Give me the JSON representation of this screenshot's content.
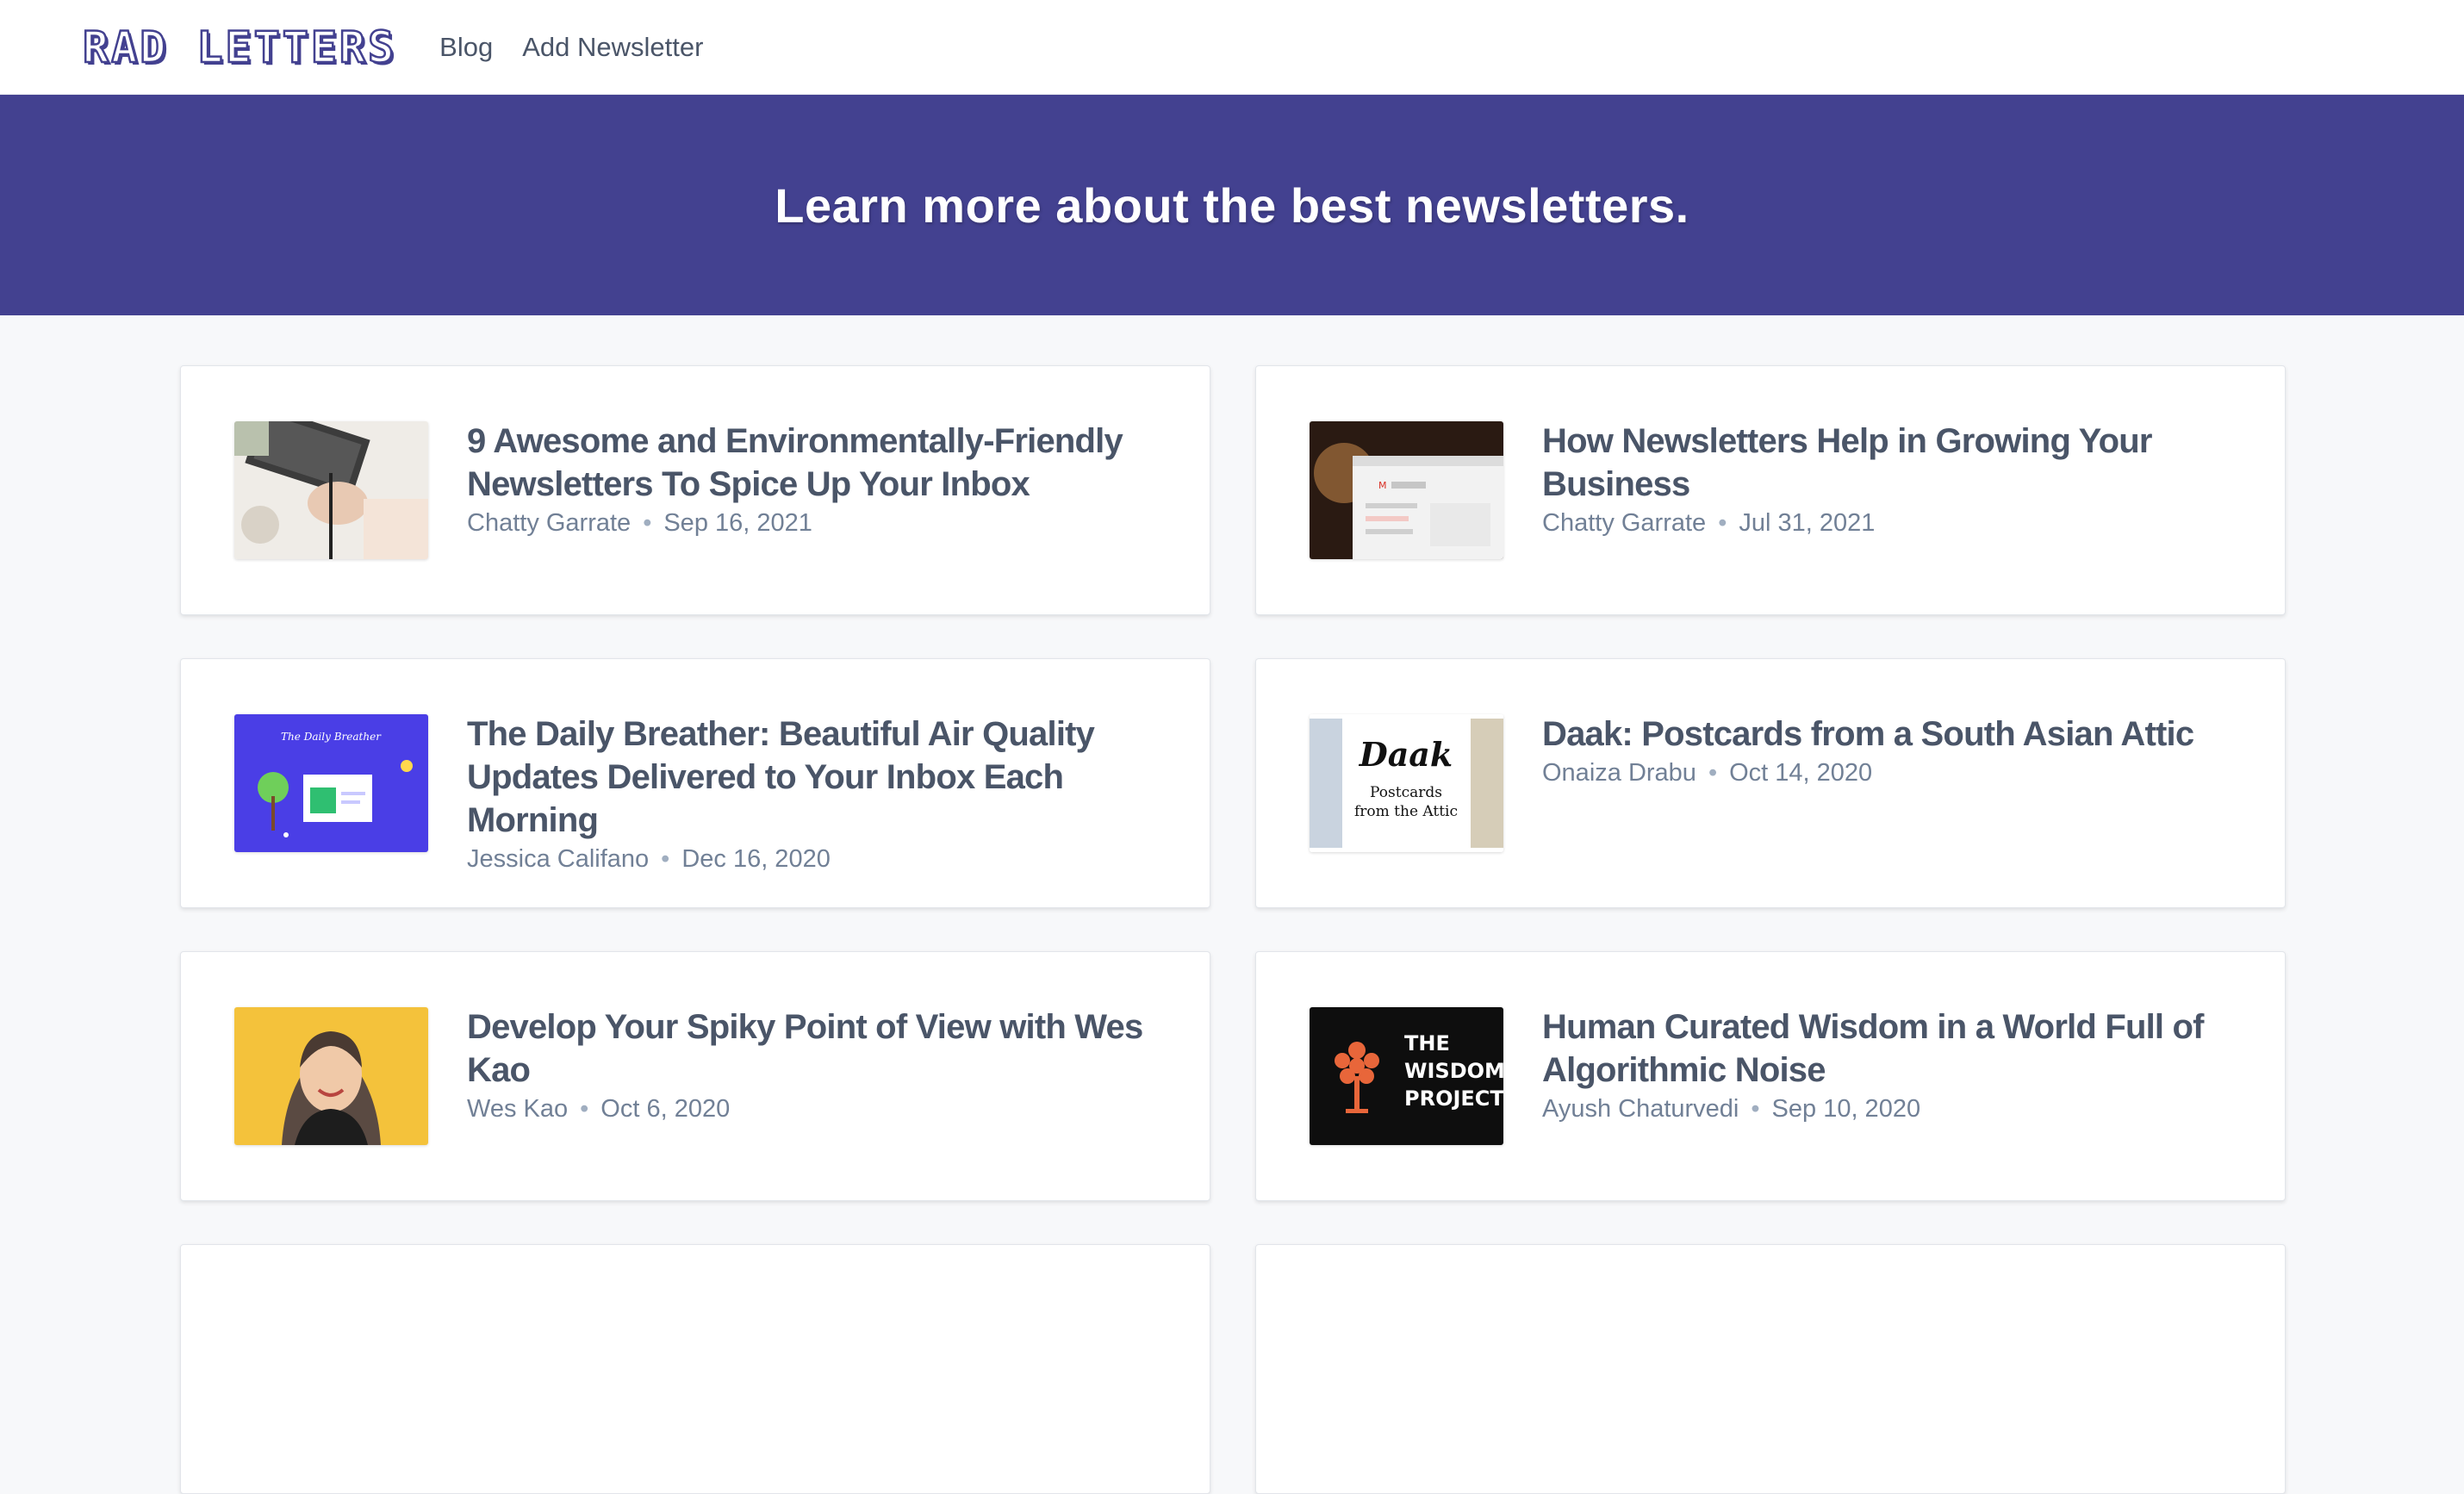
{
  "header": {
    "logo": "RAD LETTERS",
    "nav": [
      "Blog",
      "Add Newsletter"
    ]
  },
  "hero": {
    "title": "Learn more about the best newsletters."
  },
  "colors": {
    "accent": "#434190",
    "background": "#f7f8fa",
    "text": "#4a5568",
    "muted": "#718096"
  },
  "posts": [
    {
      "title": "9 Awesome and Environmentally-Friendly Newsletters To Spice Up Your Inbox",
      "author": "Chatty Garrate",
      "date": "Sep 16, 2021",
      "thumb": "laptop-desk-photo"
    },
    {
      "title": "How Newsletters Help in Growing Your Business",
      "author": "Chatty Garrate",
      "date": "Jul 31, 2021",
      "thumb": "gmail-screen-photo"
    },
    {
      "title": "The Daily Breather: Beautiful Air Quality Updates Delivered to Your Inbox Each Morning",
      "author": "Jessica Califano",
      "date": "Dec 16, 2020",
      "thumb": "daily-breather-illustration",
      "thumb_text": "The Daily Breather"
    },
    {
      "title": "Daak: Postcards from a South Asian Attic",
      "author": "Onaiza Drabu",
      "date": "Oct 14, 2020",
      "thumb": "daak-postcard-logo",
      "thumb_text": [
        "Daak",
        "Postcards",
        "from the Attic"
      ]
    },
    {
      "title": "Develop Your Spiky Point of View with Wes Kao",
      "author": "Wes Kao",
      "date": "Oct 6, 2020",
      "thumb": "wes-kao-portrait"
    },
    {
      "title": "Human Curated Wisdom in a World Full of Algorithmic Noise",
      "author": "Ayush Chaturvedi",
      "date": "Sep 10, 2020",
      "thumb": "wisdom-project-logo",
      "thumb_text": [
        "THE",
        "WISDOM",
        "PROJECT"
      ]
    }
  ]
}
